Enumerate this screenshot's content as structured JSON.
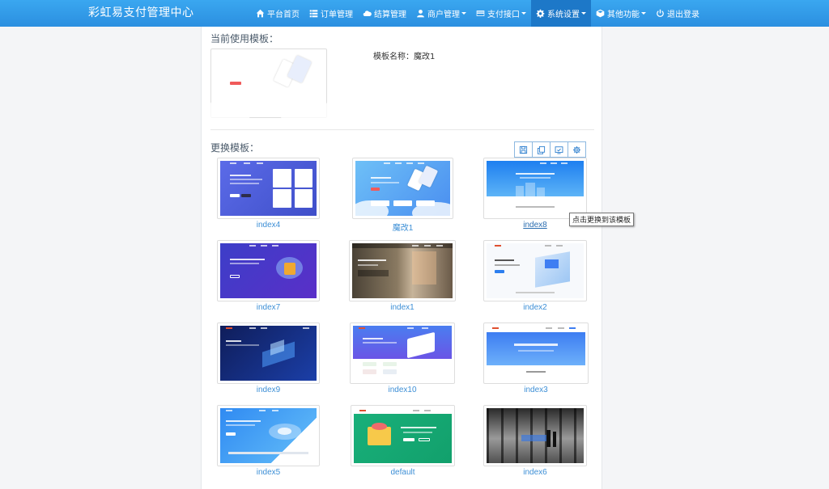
{
  "header": {
    "brand": "彩虹易支付管理中心",
    "nav": [
      {
        "label": "平台首页",
        "icon": "home-icon",
        "dropdown": false,
        "active": false
      },
      {
        "label": "订单管理",
        "icon": "list-icon",
        "dropdown": false,
        "active": false
      },
      {
        "label": "结算管理",
        "icon": "cloud-icon",
        "dropdown": false,
        "active": false
      },
      {
        "label": "商户管理",
        "icon": "user-icon",
        "dropdown": true,
        "active": false
      },
      {
        "label": "支付接口",
        "icon": "credit-card-icon",
        "dropdown": true,
        "active": false
      },
      {
        "label": "系统设置",
        "icon": "gear-icon",
        "dropdown": true,
        "active": true
      },
      {
        "label": "其他功能",
        "icon": "cube-icon",
        "dropdown": true,
        "active": false
      },
      {
        "label": "退出登录",
        "icon": "power-icon",
        "dropdown": false,
        "active": false
      }
    ]
  },
  "current": {
    "heading": "当前使用模板：",
    "name_text": "模板名称：魔改1"
  },
  "change": {
    "heading": "更换模板："
  },
  "toolbar": [
    {
      "icon": "save-icon",
      "name": "save-button"
    },
    {
      "icon": "copy-icon",
      "name": "copy-button"
    },
    {
      "icon": "preview-icon",
      "name": "preview-button"
    },
    {
      "icon": "settings-icon",
      "name": "settings-button"
    }
  ],
  "templates": [
    {
      "id": "index4",
      "label": "index4"
    },
    {
      "id": "mogai1",
      "label": "魔改1"
    },
    {
      "id": "index8",
      "label": "index8"
    },
    {
      "id": "index7",
      "label": "index7"
    },
    {
      "id": "index1",
      "label": "index1"
    },
    {
      "id": "index2",
      "label": "index2"
    },
    {
      "id": "index9",
      "label": "index9"
    },
    {
      "id": "index10",
      "label": "index10"
    },
    {
      "id": "index3",
      "label": "index3"
    },
    {
      "id": "index5",
      "label": "index5"
    },
    {
      "id": "default",
      "label": "default"
    },
    {
      "id": "index6",
      "label": "index6"
    }
  ],
  "tooltip": "点击更换到该模板",
  "colors": {
    "navbar": "#2b8fe0",
    "nav_active": "#1d78c8",
    "link": "#3d8fd6"
  }
}
